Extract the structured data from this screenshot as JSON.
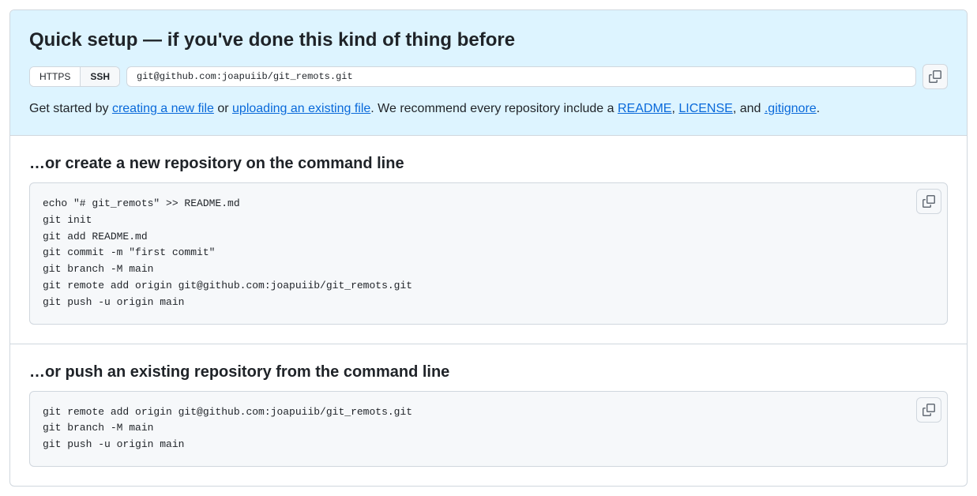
{
  "quickSetup": {
    "heading": "Quick setup — if you've done this kind of thing before",
    "httpsLabel": "HTTPS",
    "sshLabel": "SSH",
    "cloneUrl": "git@github.com:joapuiib/git_remots.git",
    "getStarted": {
      "prefix": "Get started by ",
      "createLink": "creating a new file",
      "or": " or ",
      "uploadLink": "uploading an existing file",
      "recommend": ". We recommend every repository include a ",
      "readmeLink": "README",
      "comma1": ", ",
      "licenseLink": "LICENSE",
      "and": ", and ",
      "gitignoreLink": ".gitignore",
      "period": "."
    }
  },
  "createRepo": {
    "heading": "…or create a new repository on the command line",
    "commands": "echo \"# git_remots\" >> README.md\ngit init\ngit add README.md\ngit commit -m \"first commit\"\ngit branch -M main\ngit remote add origin git@github.com:joapuiib/git_remots.git\ngit push -u origin main"
  },
  "pushRepo": {
    "heading": "…or push an existing repository from the command line",
    "commands": "git remote add origin git@github.com:joapuiib/git_remots.git\ngit branch -M main\ngit push -u origin main"
  }
}
